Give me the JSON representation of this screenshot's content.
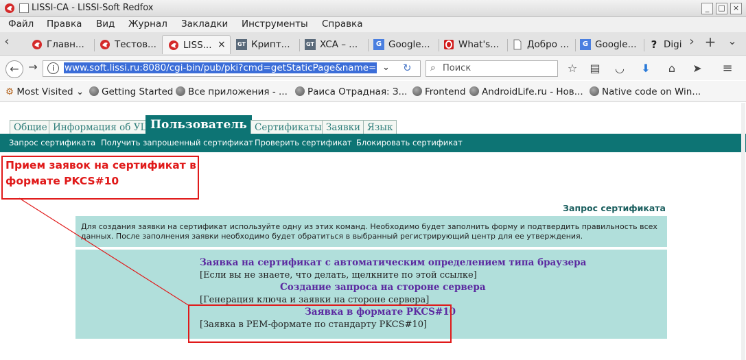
{
  "window": {
    "title": "LISSI-CA - LISSI-Soft Redfox",
    "controls": [
      "_",
      "□",
      "×"
    ]
  },
  "menu": [
    "Файл",
    "Правка",
    "Вид",
    "Журнал",
    "Закладки",
    "Инструменты",
    "Справка"
  ],
  "tabs": [
    {
      "label": "Главн...",
      "icon": "redfox-icon"
    },
    {
      "label": "Тестов...",
      "icon": "redfox-icon"
    },
    {
      "label": "LISS...",
      "icon": "redfox-icon",
      "close": "×"
    },
    {
      "label": "Крипт...",
      "icon": "gt-icon",
      "icon_text": "GT"
    },
    {
      "label": "XCA – ...",
      "icon": "gt-icon",
      "icon_text": "GT"
    },
    {
      "label": "Google...",
      "icon": "google-translate-icon"
    },
    {
      "label": "What's...",
      "icon": "opera-icon"
    },
    {
      "label": "Добро ...",
      "icon": "page-icon"
    },
    {
      "label": "Google...",
      "icon": "google-translate-icon"
    },
    {
      "label": "Digi",
      "icon": "question-icon",
      "icon_text": "?"
    }
  ],
  "tab_controls": {
    "prev": "‹",
    "next": "›",
    "new_tab": "+",
    "list": "⌄"
  },
  "nav": {
    "url": "www.soft.lissi.ru:8080/cgi-bin/pub/pki?cmd=getStaticPage&name=inde",
    "search_placeholder": "Поиск"
  },
  "bookmarks": [
    {
      "label": "Most Visited",
      "icon": "gear-icon"
    },
    {
      "label": "Getting Started",
      "icon": "globe-icon"
    },
    {
      "label": "Все приложения - ...",
      "icon": "globe-icon"
    },
    {
      "label": "Раиса Отрадная: З...",
      "icon": "globe-icon"
    },
    {
      "label": "Frontend",
      "icon": "globe-icon"
    },
    {
      "label": "AndroidLife.ru - Нов...",
      "icon": "globe-icon"
    },
    {
      "label": "Native code on Win...",
      "icon": "globe-icon"
    }
  ],
  "page": {
    "top_tabs": [
      "Общие",
      "Информация об УЦ",
      "Пользователь",
      "Сертификаты",
      "Заявки",
      "Язык"
    ],
    "subnav": [
      "Запрос сертификата",
      "Получить запрошенный сертификат",
      "Проверить сертификат",
      "Блокировать сертификат"
    ],
    "annotation": "Прием заявок на сертификат в формате PKCS#10",
    "section_title": "Запрос сертификата",
    "info": "Для создания заявки на сертификат используйте одну из этих команд. Необходимо будет заполнить форму и подтвердить правильность всех данных. После заполнения заявки необходимо будет обратиться в выбранный регистрирующий центр для ее утверждения.",
    "actions": [
      {
        "link": "Заявка на сертификат с автоматическим определением типа браузера",
        "desc": "[Если вы не знаете, что делать, щелкните по этой ссылке]"
      },
      {
        "link": "Создание запроса на стороне сервера",
        "desc": "[Генерация ключа и заявки на стороне сервера]"
      },
      {
        "link": "Заявка в формате PKCS#10",
        "desc": "[Заявка в PEM-формате по стандарту PKCS#10]"
      }
    ]
  },
  "colors": {
    "teal": "#0d7474",
    "panel": "#b1dfdb",
    "link": "#5b2aa0",
    "annotation": "#e01919"
  }
}
